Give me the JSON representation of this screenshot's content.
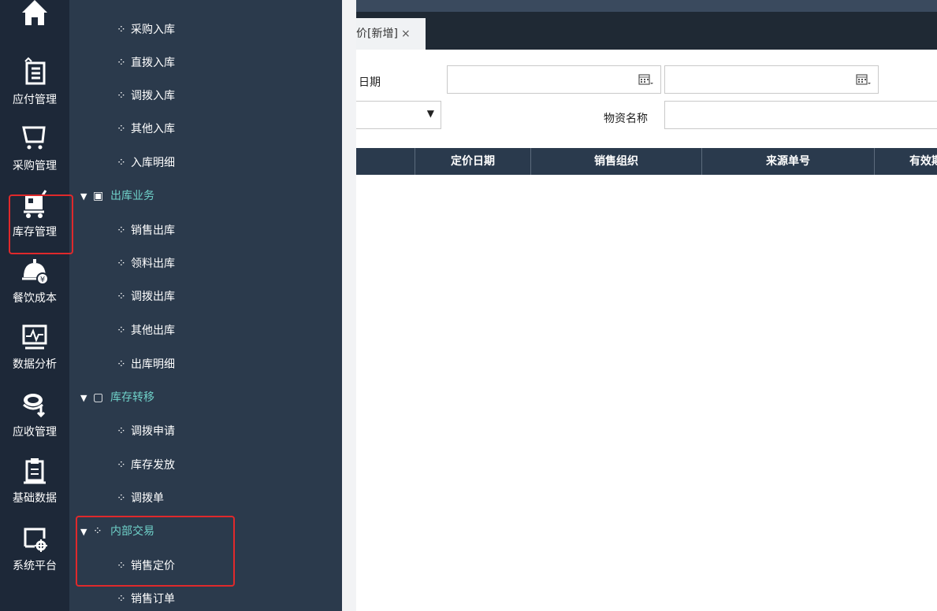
{
  "rail": {
    "items": [
      {
        "label": "",
        "icon": "home-icon"
      },
      {
        "label": "应付管理",
        "icon": "payable-icon"
      },
      {
        "label": "采购管理",
        "icon": "cart-icon"
      },
      {
        "label": "库存管理",
        "icon": "inventory-cart-icon"
      },
      {
        "label": "餐饮成本",
        "icon": "catering-cost-icon"
      },
      {
        "label": "数据分析",
        "icon": "monitor-chart-icon"
      },
      {
        "label": "应收管理",
        "icon": "coins-icon"
      },
      {
        "label": "基础数据",
        "icon": "clipboard-icon"
      },
      {
        "label": "系统平台",
        "icon": "system-settings-icon"
      }
    ]
  },
  "menu": {
    "items": [
      {
        "text": "采购入库"
      },
      {
        "text": "直拨入库"
      },
      {
        "text": "调拨入库"
      },
      {
        "text": "其他入库"
      },
      {
        "text": "入库明细"
      },
      {
        "text": "出库业务",
        "group": true
      },
      {
        "text": "销售出库"
      },
      {
        "text": "领料出库"
      },
      {
        "text": "调拨出库"
      },
      {
        "text": "其他出库"
      },
      {
        "text": "出库明细"
      },
      {
        "text": "库存转移",
        "group": true
      },
      {
        "text": "调拨申请"
      },
      {
        "text": "库存发放"
      },
      {
        "text": "调拨单"
      },
      {
        "text": "内部交易",
        "group": true
      },
      {
        "text": "销售定价"
      },
      {
        "text": "销售订单"
      }
    ]
  },
  "tab": {
    "label": "价[新增]",
    "close": "×"
  },
  "filters": {
    "date_label": "日期",
    "material_label": "物资名称",
    "date_from": "",
    "date_to": "",
    "material_value": ""
  },
  "table": {
    "columns": [
      "定价日期",
      "销售组织",
      "来源单号",
      "有效期"
    ]
  },
  "colors": {
    "highlight": "#e0292b",
    "group_text": "#6fd1c9",
    "rail_bg": "#1d2838",
    "menu_bg": "#2b3a4c"
  }
}
